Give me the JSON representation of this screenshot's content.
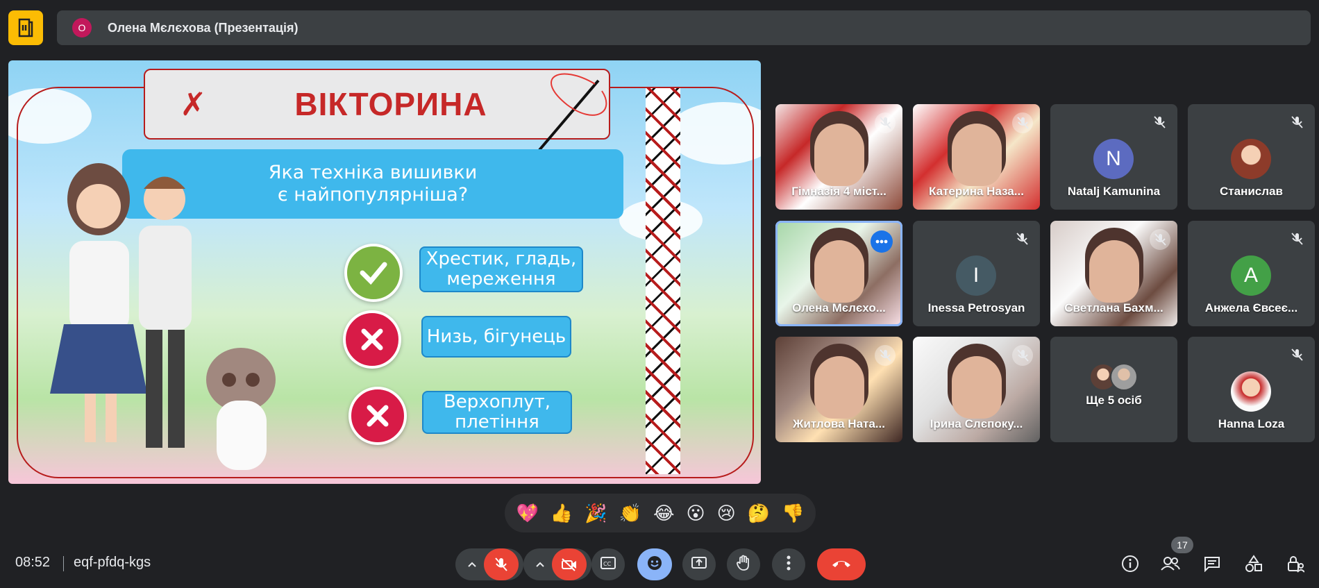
{
  "header": {
    "presenter_initial": "О",
    "presenter_label": "Олена Мєлєхова (Презентація)"
  },
  "slide": {
    "title": "ВІКТОРИНА",
    "question": "Яка техніка вишивки\nє найпопулярніша?",
    "answers": [
      {
        "text": "Хрестик, гладь,\nмереження",
        "correct": true
      },
      {
        "text": "Низь, бігунець",
        "correct": false
      },
      {
        "text": "Верхоплут,\nплетіння",
        "correct": false
      }
    ]
  },
  "participants": [
    {
      "name": "Гімназія 4 міст...",
      "type": "video",
      "muted": true
    },
    {
      "name": "Катерина Наза...",
      "type": "video",
      "muted": true
    },
    {
      "name": "Natalj Kamunina",
      "type": "avatar",
      "initial": "N",
      "color": "#5c6bc0",
      "muted": true
    },
    {
      "name": "Станислав",
      "type": "photo-avatar",
      "muted": true
    },
    {
      "name": "Олена Мєлєхо...",
      "type": "video",
      "muted": false,
      "active": true
    },
    {
      "name": "Inessa Petrosyan",
      "type": "avatar",
      "initial": "I",
      "color": "#455a64",
      "muted": true
    },
    {
      "name": "Светлана Бахм...",
      "type": "video",
      "muted": true
    },
    {
      "name": "Анжела Євсеє...",
      "type": "avatar",
      "initial": "А",
      "color": "#43a047",
      "muted": true
    },
    {
      "name": "Житлова Ната...",
      "type": "video",
      "muted": true
    },
    {
      "name": "Ірина Слєпоку...",
      "type": "video",
      "muted": true
    },
    {
      "name": "Ще 5 осіб",
      "type": "more",
      "muted": false
    },
    {
      "name": "Hanna Loza",
      "type": "photo-avatar",
      "muted": true
    }
  ],
  "reactions": [
    "💖",
    "👍",
    "🎉",
    "👏",
    "😂",
    "😮",
    "😢",
    "🤔",
    "👎"
  ],
  "footer": {
    "time": "08:52",
    "meeting_code": "eqf-pfdq-kgs",
    "participant_count": "17"
  },
  "colors": {
    "background": "#202124",
    "accent_yellow": "#fbbc04",
    "end_call": "#ea4335",
    "active_blue": "#8ab4f8"
  }
}
